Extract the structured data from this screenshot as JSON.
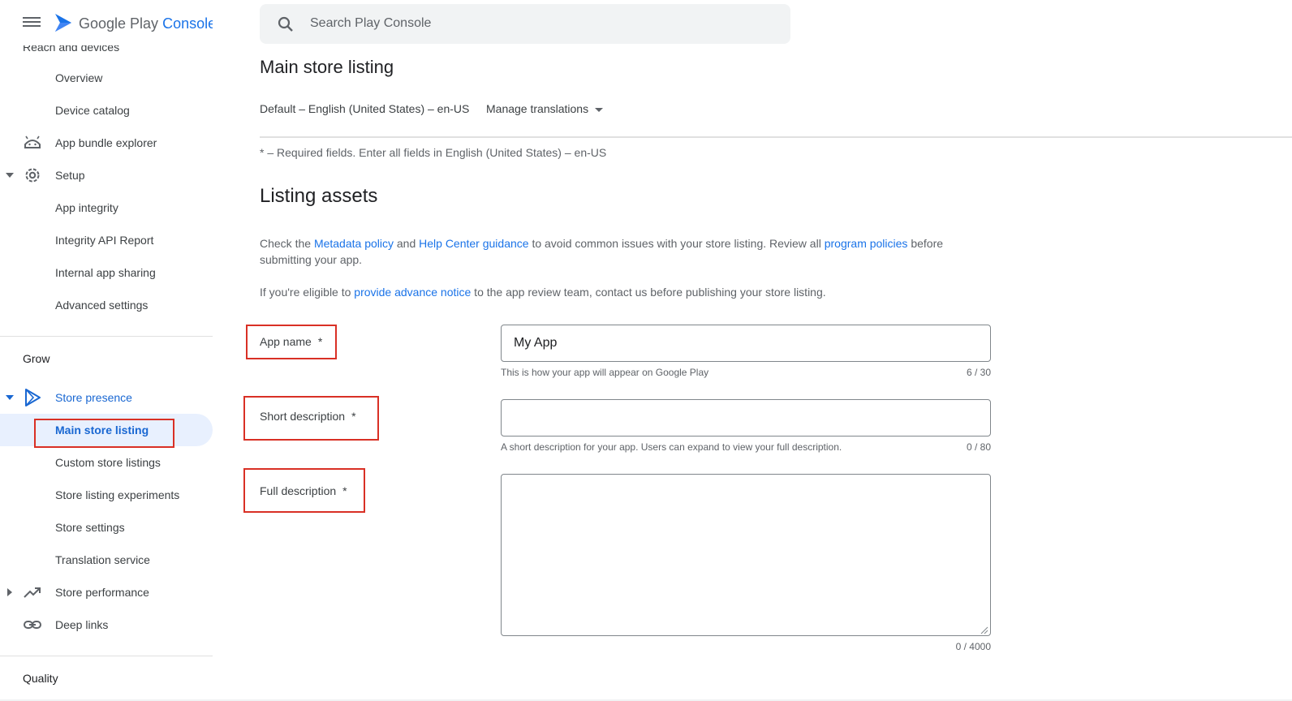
{
  "brand": {
    "name": "Google Play",
    "product": "Console"
  },
  "sidebar": {
    "partial_label": "Reach and devices",
    "items": [
      {
        "label": "Overview"
      },
      {
        "label": "Device catalog"
      },
      {
        "label": "App bundle explorer"
      },
      {
        "label": "Setup"
      },
      {
        "label": "App integrity"
      },
      {
        "label": "Integrity API Report"
      },
      {
        "label": "Internal app sharing"
      },
      {
        "label": "Advanced settings"
      },
      {
        "label": "Store presence"
      },
      {
        "label": "Main store listing"
      },
      {
        "label": "Custom store listings"
      },
      {
        "label": "Store listing experiments"
      },
      {
        "label": "Store settings"
      },
      {
        "label": "Translation service"
      },
      {
        "label": "Store performance"
      },
      {
        "label": "Deep links"
      }
    ],
    "sections": {
      "grow": "Grow",
      "quality": "Quality"
    }
  },
  "search": {
    "placeholder": "Search Play Console"
  },
  "page": {
    "title": "Main store listing",
    "language": "Default – English (United States) – en-US",
    "manage_translations": "Manage translations",
    "required_note": "* – Required fields. Enter all fields in English (United States) – en-US",
    "section_title": "Listing assets",
    "para1": {
      "t1": "Check the ",
      "link1": "Metadata policy",
      "t2": " and ",
      "link2": "Help Center guidance",
      "t3": " to avoid common issues with your store listing. Review all ",
      "link3": "program policies",
      "t4": " before submitting your app."
    },
    "para2": {
      "t1": "If you're eligible to ",
      "link1": "provide advance notice",
      "t2": " to the app review team, contact us before publishing your store listing."
    }
  },
  "fields": {
    "app_name": {
      "label": "App name",
      "required": "*",
      "value": "My App",
      "hint": "This is how your app will appear on Google Play",
      "count": "6 / 30"
    },
    "short_description": {
      "label": "Short description",
      "required": "*",
      "value": "",
      "hint": "A short description for your app. Users can expand to view your full description.",
      "count": "0 / 80"
    },
    "full_description": {
      "label": "Full description",
      "required": "*",
      "value": "",
      "count": "0 / 4000"
    }
  },
  "colors": {
    "accent": "#1a73e8",
    "highlight": "#d93025",
    "active_bg": "#e8f0fe"
  }
}
